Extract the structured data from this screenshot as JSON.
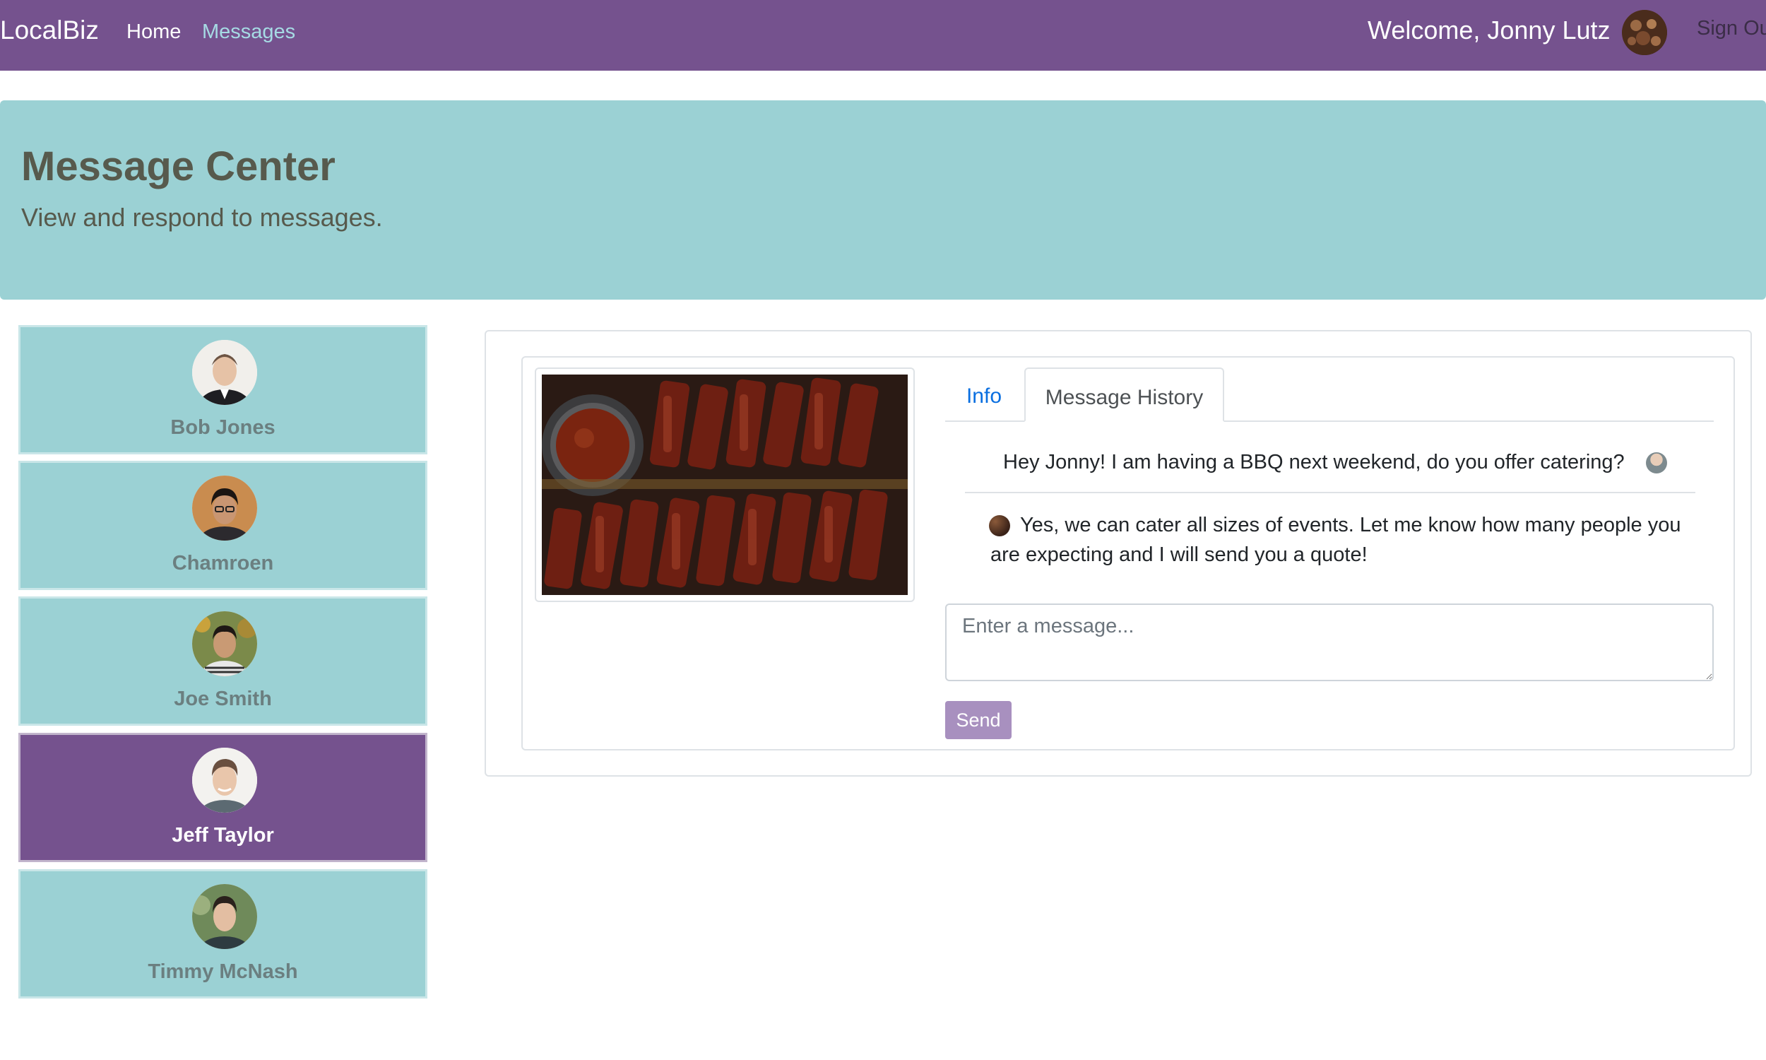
{
  "navbar": {
    "brand": "LocalBiz",
    "links": [
      {
        "label": "Home"
      },
      {
        "label": "Messages"
      }
    ],
    "welcome": "Welcome, Jonny Lutz",
    "sign_out": "Sign Ou"
  },
  "jumbotron": {
    "title": "Message Center",
    "subtitle": "View and respond to messages."
  },
  "contacts": [
    {
      "name": "Bob Jones",
      "active": false
    },
    {
      "name": "Chamroen",
      "active": false
    },
    {
      "name": "Joe Smith",
      "active": false
    },
    {
      "name": "Jeff Taylor",
      "active": true
    },
    {
      "name": "Timmy McNash",
      "active": false
    }
  ],
  "conversation": {
    "tabs": [
      {
        "label": "Info",
        "active": false
      },
      {
        "label": "Message History",
        "active": true
      }
    ],
    "messages": [
      {
        "from": "Jeff Taylor",
        "text": "Hey Jonny! I am having a BBQ next weekend, do you offer catering?"
      },
      {
        "from": "Jonny Lutz",
        "text": "Yes, we can cater all sizes of events. Let me know how many people you are expecting and I will send you a quote!"
      }
    ],
    "input_placeholder": "Enter a message...",
    "send_label": "Send"
  },
  "colors": {
    "navbar": "#75528e",
    "active_link": "#a6dbe4",
    "jumbotron": "#9bd1d4",
    "contact_card": "#9bd1d4",
    "contact_active": "#75528e",
    "tab_link": "#0a6fe0",
    "send_button": "#a890bf"
  }
}
